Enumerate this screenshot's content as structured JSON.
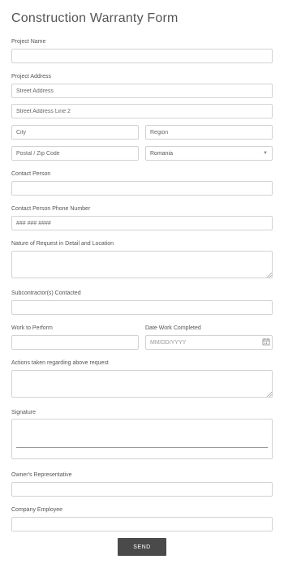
{
  "form": {
    "title": "Construction Warranty Form",
    "project_name": {
      "label": "Project Name",
      "value": ""
    },
    "project_address": {
      "label": "Project Address",
      "street_placeholder": "Street Address",
      "street2_placeholder": "Street Address Line 2",
      "city_placeholder": "City",
      "region_placeholder": "Region",
      "postal_placeholder": "Postal / Zip Code",
      "country_value": "Romania"
    },
    "contact_person": {
      "label": "Contact Person",
      "value": ""
    },
    "contact_phone": {
      "label": "Contact Person Phone Number",
      "placeholder": "### ### ####"
    },
    "nature_of_request": {
      "label": "Nature of Request in Detail and Location",
      "value": ""
    },
    "subcontractors": {
      "label": "Subcontractor(s) Contacted",
      "value": ""
    },
    "work_to_perform": {
      "label": "Work to Perform",
      "value": ""
    },
    "date_work_completed": {
      "label": "Date Work Completed",
      "placeholder": "MM/DD/YYYY",
      "icon": "calendar-icon"
    },
    "actions_taken": {
      "label": "Actions taken regarding above request",
      "value": ""
    },
    "signature": {
      "label": "Signature"
    },
    "owners_rep": {
      "label": "Owner's Representative",
      "value": ""
    },
    "company_employee": {
      "label": "Company Employee",
      "value": ""
    },
    "send_label": "SEND"
  },
  "colors": {
    "button_bg": "#4a4a4a",
    "border": "#d3d3d3",
    "text": "#555555"
  }
}
